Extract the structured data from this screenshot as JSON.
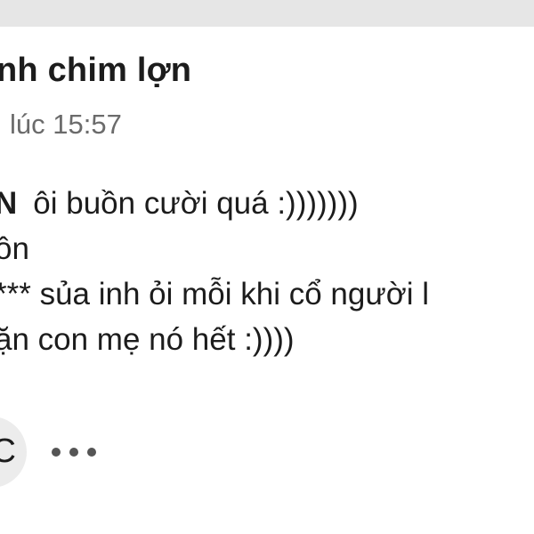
{
  "post": {
    "author": "nh chim lợn",
    "time": "lúc 15:57",
    "mention": "N",
    "lines": [
      "ôi buồn cười quá :)))))))",
      "ồn",
      "*** sủa inh ỏi mỗi khi cổ người l",
      "ặn con mẹ nó hết :))))"
    ]
  },
  "footer": {
    "avatar_letter": "C",
    "more_icon": "more-horizontal-icon"
  },
  "colors": {
    "top_bar": "#e6e6e6",
    "text": "#1c1c1c",
    "muted_text": "#6b6b6b",
    "avatar_bg": "#ececec"
  }
}
